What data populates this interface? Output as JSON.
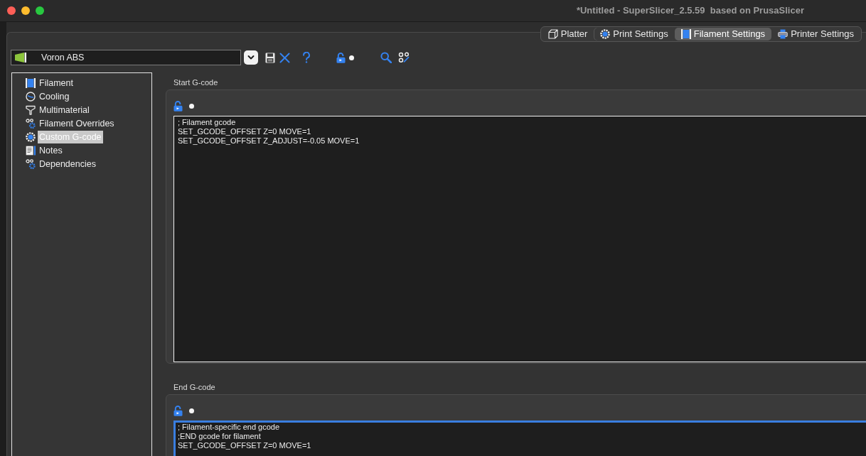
{
  "window": {
    "title": "*Untitled - SuperSlicer_2.5.59  based on PrusaSlicer"
  },
  "tabs": [
    {
      "label": "Platter",
      "selected": false
    },
    {
      "label": "Print Settings",
      "selected": false
    },
    {
      "label": "Filament Settings",
      "selected": true
    },
    {
      "label": "Printer Settings",
      "selected": false
    }
  ],
  "preset": {
    "value": "Voron ABS"
  },
  "sidebar": {
    "items": [
      {
        "label": "Filament",
        "selected": false
      },
      {
        "label": "Cooling",
        "selected": false
      },
      {
        "label": "Multimaterial",
        "selected": false
      },
      {
        "label": "Filament Overrides",
        "selected": false
      },
      {
        "label": "Custom G-code",
        "selected": true
      },
      {
        "label": "Notes",
        "selected": false
      },
      {
        "label": "Dependencies",
        "selected": false
      }
    ]
  },
  "sections": [
    {
      "title": "Start G-code",
      "focused": false,
      "value": "; Filament gcode\nSET_GCODE_OFFSET Z=0 MOVE=1\nSET_GCODE_OFFSET Z_ADJUST=-0.05 MOVE=1"
    },
    {
      "title": "End G-code",
      "focused": true,
      "value": "; Filament-specific end gcode\n;END gcode for filament\nSET_GCODE_OFFSET Z=0 MOVE=1"
    }
  ]
}
